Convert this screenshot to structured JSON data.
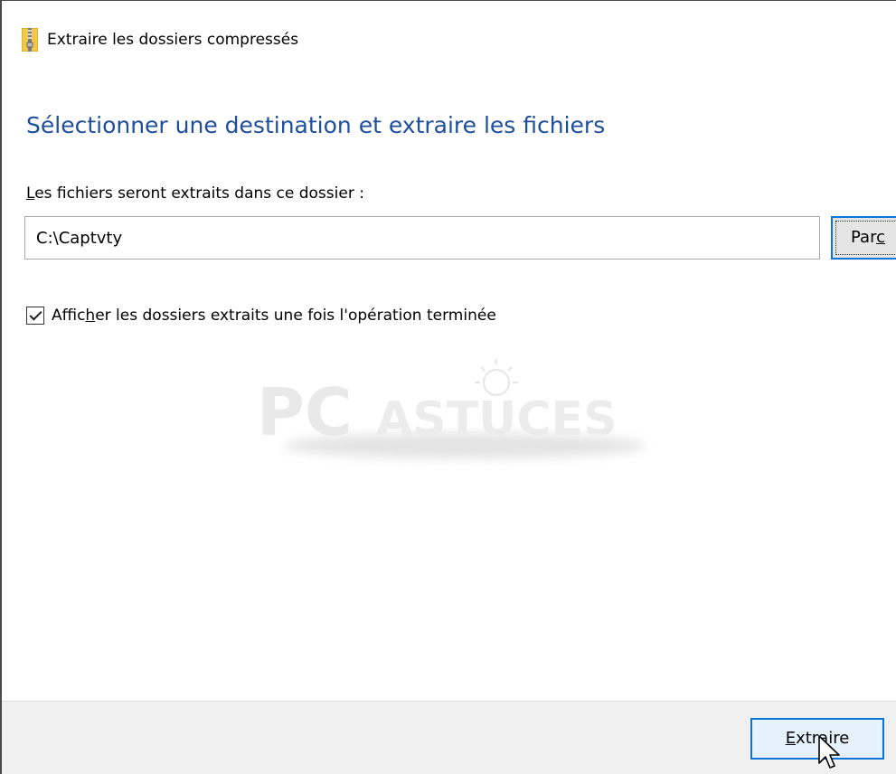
{
  "window": {
    "title": "Extraire les dossiers compressés",
    "icon": "zip-folder-icon"
  },
  "main": {
    "heading": "Sélectionner une destination et extraire les fichiers",
    "destination_label_first": "L",
    "destination_label_rest": "es fichiers seront extraits dans ce dossier :",
    "destination_path": "C:\\Captvty",
    "browse_label_first": "Par",
    "browse_label_accel": "c",
    "show_files_checked": true,
    "show_files_label_pre": "Affic",
    "show_files_label_accel": "h",
    "show_files_label_post": "er les dossiers extraits une fois l'opération terminée"
  },
  "watermark": {
    "text_pc": "PC",
    "text_astuces": "ASTUCES"
  },
  "footer": {
    "extract_accel": "E",
    "extract_rest": "xtraire"
  },
  "colors": {
    "heading": "#1e4f9c",
    "focus_border": "#0b74d6",
    "footer_bg": "#f0f0f0"
  }
}
